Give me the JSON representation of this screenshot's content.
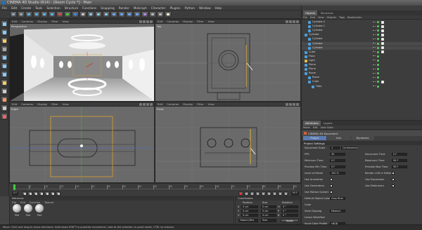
{
  "titlebar": {
    "title": "CINEMA 4D Studio (R14) - [Room Cycle *] - Main"
  },
  "menubar": [
    "File",
    "Edit",
    "Create",
    "Tools",
    "Selection",
    "Structure",
    "Functions",
    "Snapping",
    "Render",
    "MoGraph",
    "Character",
    "Plugins",
    "Python",
    "Window",
    "Help"
  ],
  "toolbar_icons": [
    "undo-icon",
    "redo-icon",
    "move-icon",
    "rotate-icon",
    "scale-icon",
    "select-icon",
    "x-axis-icon",
    "y-axis-icon",
    "z-axis-icon",
    "coord-icon",
    "render-view-icon",
    "render-pv-icon",
    "render-settings-icon",
    "cube-icon",
    "spline-icon",
    "nurbs-icon",
    "array-icon",
    "deformer-icon",
    "scene-icon",
    "camera-icon",
    "light-icon"
  ],
  "viewports": {
    "perspective": {
      "label": "Perspective",
      "menu": [
        "Edit",
        "Cameras",
        "Display",
        "Filter",
        "View"
      ]
    },
    "top": {
      "label": "Top",
      "menu": [
        "Edit",
        "Cameras",
        "Display",
        "Filter",
        "View"
      ]
    },
    "right": {
      "label": "Right",
      "menu": [
        "Edit",
        "Cameras",
        "Display",
        "Filter",
        "View"
      ]
    },
    "front": {
      "label": "Front",
      "menu": [
        "Edit",
        "Cameras",
        "Display",
        "Filter",
        "View"
      ]
    }
  },
  "object_manager": {
    "tabs": [
      "Objects",
      "Structure"
    ],
    "menu": [
      "File",
      "Edit",
      "View",
      "Objects",
      "Tags",
      "Bookmarks"
    ],
    "items": [
      {
        "label": "Cylinder.2",
        "indent": 1,
        "color": "#4aa0e0"
      },
      {
        "label": "Cylinder.1",
        "indent": 1,
        "color": "#4aa0e0"
      },
      {
        "label": "Cylinder",
        "indent": 1,
        "color": "#4aa0e0"
      },
      {
        "label": "Cylinder",
        "indent": 0,
        "color": "#4aa0e0"
      },
      {
        "label": "Cylinder",
        "indent": 1,
        "color": "#4aa0e0"
      },
      {
        "label": "Cylinder",
        "indent": 1,
        "color": "#4aa0e0"
      },
      {
        "label": "Cylinder",
        "indent": 1,
        "color": "#4aa0e0"
      },
      {
        "label": "Cube",
        "indent": 0,
        "color": "#4aa0e0"
      },
      {
        "label": "Floor",
        "indent": 0,
        "color": "#4aa0e0"
      },
      {
        "label": "Light",
        "indent": 0,
        "color": "#e0c040"
      },
      {
        "label": "Plane",
        "indent": 0,
        "color": "#4aa0e0"
      },
      {
        "label": "Plane",
        "indent": 0,
        "color": "#4aa0e0"
      },
      {
        "label": "Room",
        "indent": 0,
        "color": "#4aa0e0"
      },
      {
        "label": "Room",
        "indent": 1,
        "color": "#4aa0e0"
      },
      {
        "label": "Cube",
        "indent": 1,
        "color": "#4aa0e0"
      },
      {
        "label": "Tube",
        "indent": 2,
        "color": "#4aa0e0"
      }
    ]
  },
  "attributes": {
    "tabs": [
      "Attributes",
      "Layers"
    ],
    "menu": [
      "Mode",
      "Edit",
      "User Data"
    ],
    "doc_title": "CINEMA 4D Document",
    "subtabs": [
      "Project Settings",
      "Info",
      "Dynamics"
    ],
    "section": "Project Settings",
    "rows": [
      {
        "label": "Document Scale",
        "value": "1",
        "extra": "Centimeters"
      },
      {
        "label": "FPS",
        "value": "30",
        "label2": "Document Time",
        "value2": "0 F"
      },
      {
        "label": "Minimum Time",
        "value": "0 F",
        "label2": "Maximum Time",
        "value2": "90 F"
      },
      {
        "label": "Preview Min Time",
        "value": "0 F",
        "label2": "Preview Max Time",
        "value2": "90 F"
      },
      {
        "label": "Level of Detail",
        "value": "100 %",
        "label2": "Render LOD in Editor",
        "value2": ""
      },
      {
        "label": "Use Animation",
        "value": "",
        "label2": "Use Expression",
        "value2": ""
      },
      {
        "label": "Use Generators",
        "value": "",
        "label2": "Use Deformers",
        "value2": ""
      },
      {
        "label": "Use Motion System",
        "value": "",
        "label2": "",
        "value2": ""
      },
      {
        "label": "Default Object Color",
        "value": "Gray Blue",
        "label2": "",
        "value2": ""
      },
      {
        "label": "Color",
        "value": "",
        "label2": "",
        "value2": ""
      },
      {
        "label": "View Clipping",
        "value": "Medium",
        "label2": "",
        "value2": ""
      },
      {
        "label": "Linear Workflow",
        "value": "",
        "label2": "",
        "value2": ""
      },
      {
        "label": "Input Color Profile",
        "value": "sRGB",
        "label2": "",
        "value2": ""
      }
    ]
  },
  "timeline": {
    "ticks": [
      "0",
      "5",
      "10",
      "15",
      "20",
      "25",
      "30",
      "35",
      "40",
      "45",
      "50",
      "55",
      "60",
      "65",
      "70",
      "75",
      "80",
      "85",
      "90"
    ],
    "start": "0 F",
    "end": "90 F",
    "current": "0 F"
  },
  "material_manager": {
    "title": "Materials",
    "menu": [
      "File",
      "Edit",
      "Function",
      "Texture"
    ],
    "materials": [
      "Mat",
      "Mat",
      "Mat"
    ]
  },
  "coordinates": {
    "title": "Coordinates",
    "headers": [
      "Position",
      "Size",
      "Rotation"
    ],
    "rows": [
      {
        "axis": "X",
        "pos": "0 cm",
        "size": "0 cm",
        "rotLabel": "H",
        "rot": "0 °"
      },
      {
        "axis": "Y",
        "pos": "0 cm",
        "size": "0 cm",
        "rotLabel": "P",
        "rot": "0 °"
      },
      {
        "axis": "Z",
        "pos": "0 cm",
        "size": "0 cm",
        "rotLabel": "B",
        "rot": "0 °"
      }
    ],
    "mode": "Object (Rel)",
    "size_mode": "Size",
    "apply": "Apply"
  },
  "status": "Move: Click and drag to move elements. Hold down SHIFT to quantize movement / add to the selection in point mode. CTRL to remove."
}
